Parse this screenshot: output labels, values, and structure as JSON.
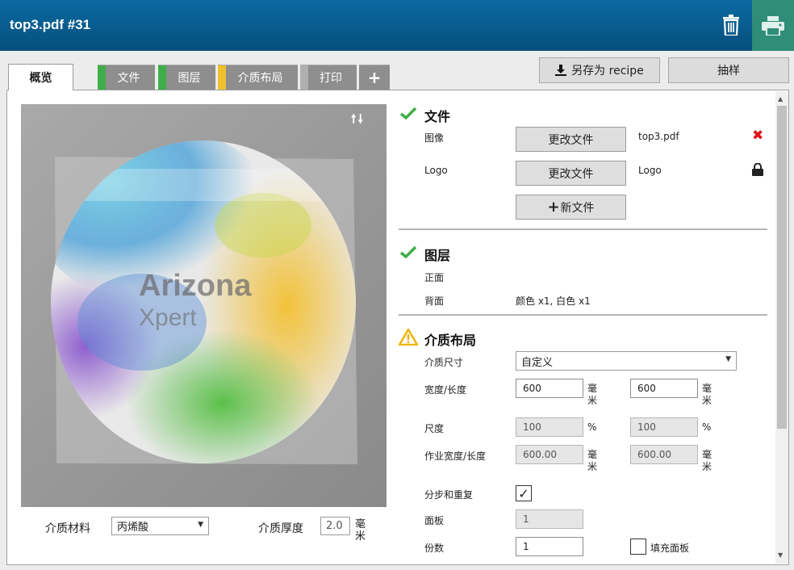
{
  "header": {
    "title": "top3.pdf #31",
    "trash_icon": "trash-icon",
    "print_icon": "printer-icon"
  },
  "tabs": [
    {
      "label": "概览"
    },
    {
      "label": "文件",
      "status_color": "#3fae4a"
    },
    {
      "label": "图层",
      "status_color": "#3fae4a"
    },
    {
      "label": "介质布局",
      "status_color": "#f0c02e"
    },
    {
      "label": "打印",
      "status_color": "#b0b0b0"
    },
    {
      "label": "+"
    }
  ],
  "toolbar": {
    "save_recipe_label": "另存为 recipe",
    "sample_label": "抽样"
  },
  "preview": {
    "watermark_line1": "Arizona",
    "watermark_line2": "Xpert",
    "arrow_up": "🠕",
    "arrow_down": "🠗"
  },
  "media": {
    "material_label": "介质材料",
    "material_value": "丙烯酸",
    "thickness_label": "介质厚度",
    "thickness_value": "2.0",
    "thickness_unit": "毫米"
  },
  "files": {
    "title": "文件",
    "image_label": "图像",
    "change_file_label": "更改文件",
    "image_file": "top3.pdf",
    "logo_label": "Logo",
    "logo_file": "Logo",
    "new_file_label": "新文件"
  },
  "layers": {
    "title": "图层",
    "front_label": "正面",
    "back_label": "背面",
    "back_value": "颜色 x1, 白色 x1"
  },
  "layout": {
    "title": "介质布局",
    "size_label": "介质尺寸",
    "size_value": "自定义",
    "width_length_label": "宽度/长度",
    "width_value": "600",
    "length_value": "600",
    "unit": "毫米",
    "scale_label": "尺度",
    "scale_x": "100",
    "scale_y": "100",
    "percent": "%",
    "job_size_label": "作业宽度/长度",
    "job_width": "600.00",
    "job_length": "600.00",
    "step_repeat_label": "分步和重复",
    "step_repeat_check": "✓",
    "panels_label": "面板",
    "panels_value": "1",
    "copies_label": "份数",
    "copies_value": "1",
    "fill_panels_label": "填充面板"
  }
}
